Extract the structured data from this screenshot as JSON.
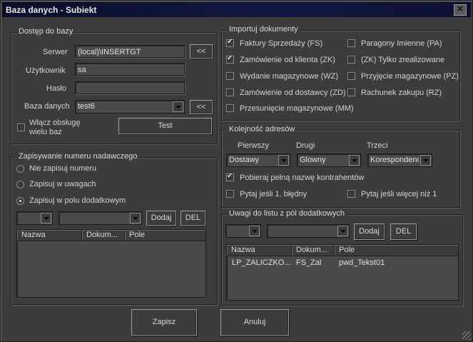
{
  "window": {
    "title": "Baza danych - Subiekt",
    "close_label": "✕"
  },
  "access": {
    "legend": "Dostęp do bazy",
    "server_label": "Serwer",
    "server_value": "(local)\\INSERTGT",
    "server_btn": "<<",
    "user_label": "Użytkownik",
    "user_value": "sa",
    "password_label": "Hasło",
    "password_value": "",
    "db_label": "Baza danych",
    "db_value": "test6",
    "db_btn": "<<",
    "multi_label_1": "Włącz obsługę",
    "multi_label_2": "wielu baz",
    "multi_checked": false,
    "test_btn": "Test"
  },
  "numbering": {
    "legend": "Zapisywanie numeru nadawczego",
    "options": [
      {
        "label": "Nie zapisuj numeru",
        "selected": false
      },
      {
        "label": "Zapisuj w uwagach",
        "selected": false
      },
      {
        "label": "Zapisuj w polu dodatkowym",
        "selected": true
      }
    ],
    "add_btn": "Dodaj",
    "del_btn": "DEL",
    "columns": [
      "Nazwa",
      "Dokum...",
      "Pole"
    ],
    "rows": []
  },
  "import": {
    "legend": "Importuj dokumenty",
    "left": [
      {
        "label": "Faktury Sprzedaży (FS)",
        "checked": true
      },
      {
        "label": "Zamówienie od klienta (ZK)",
        "checked": true
      },
      {
        "label": "Wydanie magazynowe (WZ)",
        "checked": false
      },
      {
        "label": "Zamówienie od dostawcy (ZD)",
        "checked": false
      },
      {
        "label": "Przesunięcie magazynowe (MM)",
        "checked": false
      }
    ],
    "right": [
      {
        "label": "Paragony Imienne (PA)",
        "checked": false
      },
      {
        "label": "(ZK) Tylko zrealizowane",
        "checked": false
      },
      {
        "label": "Przyjęcie magazynowe (PZ)",
        "checked": false
      },
      {
        "label": "Rachunek zakupu (RZ)",
        "checked": false
      }
    ]
  },
  "address": {
    "legend": "Kolejność adresów",
    "first_label": "Pierwszy",
    "first_value": "Dostawy",
    "second_label": "Drugi",
    "second_value": "Glowny",
    "third_label": "Trzeci",
    "third_value": "Korespondencyjny",
    "fullname_label": "Pobieraj pełną nazwę kontrahentów",
    "fullname_checked": true,
    "ask1_label": "Pytaj jeśli 1. błędny",
    "ask1_checked": false,
    "askmore_label": "Pytaj jeśli więcej niż 1",
    "askmore_checked": false
  },
  "notes": {
    "legend": "Uwagi do listu z pól dodatkowych",
    "add_btn": "Dodaj",
    "del_btn": "DEL",
    "columns": [
      "Nazwa",
      "Dokum...",
      "Pole"
    ],
    "rows": [
      [
        "LP_ZALICZKO...",
        "FS_Zal",
        "pwd_Tekst01"
      ]
    ]
  },
  "footer": {
    "save_btn": "Zapisz",
    "cancel_btn": "Anuluj"
  }
}
